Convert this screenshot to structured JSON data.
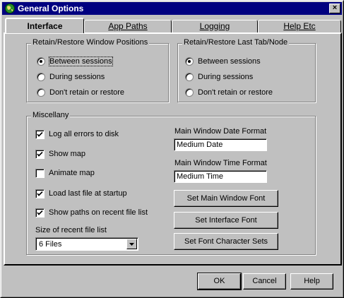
{
  "window": {
    "title": "General Options",
    "close_label": "×"
  },
  "tabs": [
    {
      "label": "Interface",
      "active": true
    },
    {
      "label": "App Paths",
      "active": false
    },
    {
      "label": "Logging",
      "active": false
    },
    {
      "label": "Help Etc",
      "active": false
    }
  ],
  "retain_window": {
    "label": "Retain/Restore Window Positions",
    "options": [
      {
        "label": "Between sessions",
        "checked": true
      },
      {
        "label": "During sessions",
        "checked": false
      },
      {
        "label": "Don't retain or restore",
        "checked": false
      }
    ]
  },
  "retain_tab": {
    "label": "Retain/Restore Last Tab/Node",
    "options": [
      {
        "label": "Between sessions",
        "checked": true
      },
      {
        "label": "During sessions",
        "checked": false
      },
      {
        "label": "Don't retain or restore",
        "checked": false
      }
    ]
  },
  "misc": {
    "label": "Miscellany",
    "checkboxes": [
      {
        "label": "Log all errors to disk",
        "checked": true
      },
      {
        "label": "Show map",
        "checked": true
      },
      {
        "label": "Animate map",
        "checked": false
      },
      {
        "label": "Load last file at startup",
        "checked": true
      },
      {
        "label": "Show paths on recent file list",
        "checked": true
      }
    ],
    "recent_size_label": "Size of recent file list",
    "recent_size_value": "6 Files",
    "date_format_label": "Main Window Date Format",
    "date_format_value": "Medium Date",
    "time_format_label": "Main Window Time Format",
    "time_format_value": "Medium Time",
    "buttons": {
      "main_font": "Set Main Window Font",
      "interface_font": "Set Interface Font",
      "charsets": "Set Font Character Sets"
    }
  },
  "footer": {
    "ok": "OK",
    "cancel": "Cancel",
    "help": "Help"
  }
}
